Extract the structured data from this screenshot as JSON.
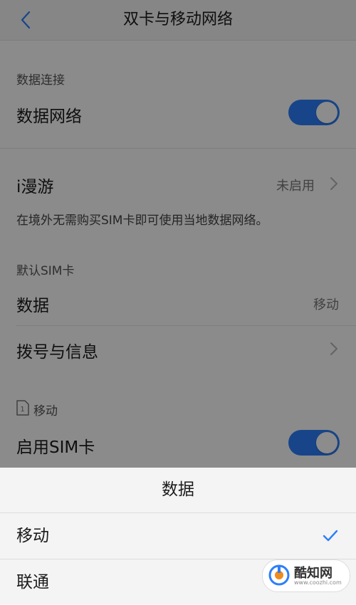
{
  "header": {
    "title": "双卡与移动网络"
  },
  "settings": {
    "data_connection_section": "数据连接",
    "data_network_label": "数据网络",
    "data_network_enabled": true,
    "iroam_label": "i漫游",
    "iroam_value": "未启用",
    "iroam_description": "在境外无需购买SIM卡即可使用当地数据网络。",
    "default_sim_section": "默认SIM卡",
    "data_label": "数据",
    "data_value": "移动",
    "dial_label": "拨号与信息",
    "sim1_section_label": "移动",
    "sim1_icon_number": "1",
    "enable_sim_label": "启用SIM卡",
    "enable_sim_enabled": true
  },
  "sheet": {
    "title": "数据",
    "options": [
      {
        "label": "移动",
        "selected": true
      },
      {
        "label": "联通",
        "selected": false
      }
    ]
  },
  "watermark": {
    "brand": "酷知网",
    "url": "www.coozhi.com"
  },
  "colors": {
    "accent": "#2d7ff9",
    "check": "#2d7ff9",
    "sheet_bg": "#f4f4f4"
  }
}
